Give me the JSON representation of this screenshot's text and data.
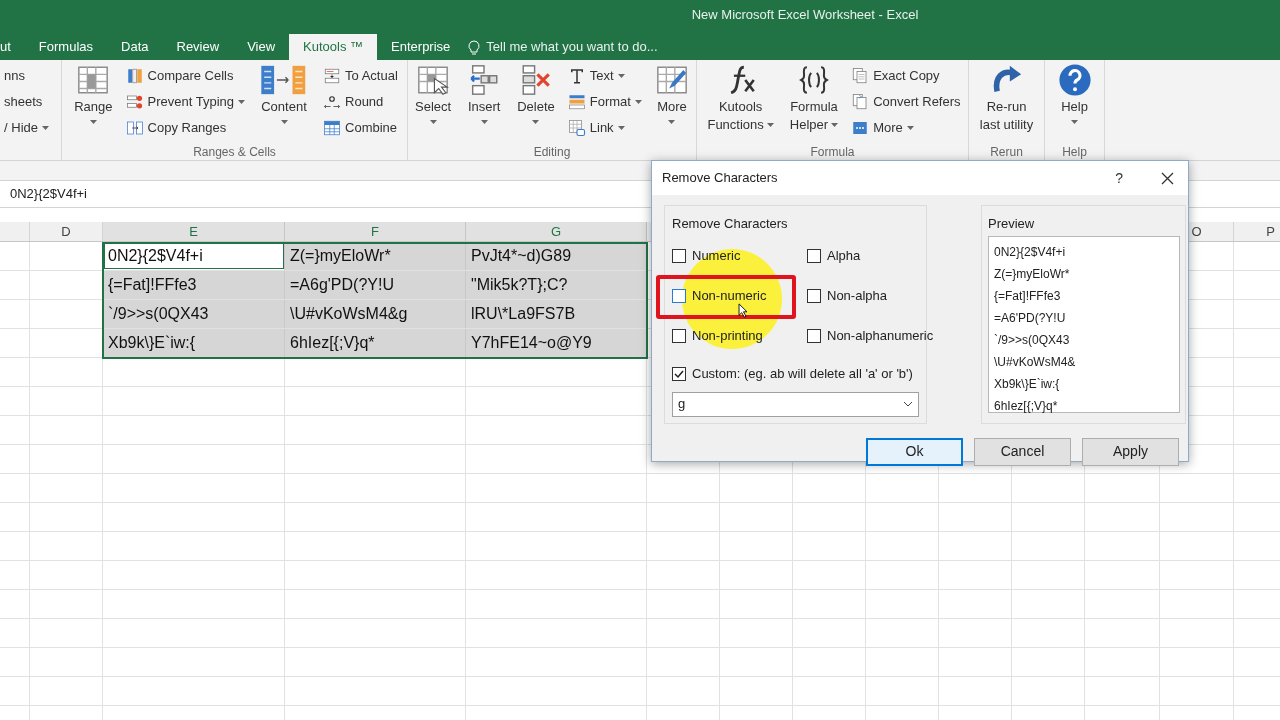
{
  "window": {
    "title": "New Microsoft Excel Worksheet - Excel"
  },
  "tabs": [
    {
      "label": "ut",
      "selected": false
    },
    {
      "label": "Formulas",
      "selected": false
    },
    {
      "label": "Data",
      "selected": false
    },
    {
      "label": "Review",
      "selected": false
    },
    {
      "label": "View",
      "selected": false
    },
    {
      "label": "Kutools ™",
      "selected": true
    },
    {
      "label": "Enterprise",
      "selected": false
    }
  ],
  "tell_me": {
    "placeholder": "Tell me what you want to do..."
  },
  "ribbon": {
    "groups": [
      {
        "items": [
          {
            "kind": "stack",
            "items": [
              {
                "label": "nns",
                "dropdown": false
              },
              {
                "label": "sheets",
                "dropdown": false
              },
              {
                "label": "/ Hide",
                "dropdown": true
              }
            ]
          }
        ]
      },
      {
        "label": "Ranges & Cells",
        "items": [
          {
            "kind": "large",
            "lines": [
              "Range"
            ],
            "dropdown": true
          },
          {
            "kind": "stack",
            "items": [
              {
                "label": "Compare Cells",
                "dropdown": false
              },
              {
                "label": "Prevent Typing",
                "dropdown": true
              },
              {
                "label": "Copy Ranges",
                "dropdown": false
              }
            ]
          },
          {
            "kind": "large",
            "lines": [
              "Content"
            ],
            "dropdown": true
          },
          {
            "kind": "stack",
            "items": [
              {
                "label": "To Actual",
                "dropdown": false
              },
              {
                "label": "Round",
                "dropdown": false
              },
              {
                "label": "Combine",
                "dropdown": false
              }
            ]
          }
        ]
      },
      {
        "label": "Editing",
        "items": [
          {
            "kind": "large",
            "lines": [
              "Select"
            ],
            "dropdown": true
          },
          {
            "kind": "large",
            "lines": [
              "Insert"
            ],
            "dropdown": true
          },
          {
            "kind": "large",
            "lines": [
              "Delete"
            ],
            "dropdown": true
          },
          {
            "kind": "stack",
            "items": [
              {
                "label": "Text",
                "dropdown": true
              },
              {
                "label": "Format",
                "dropdown": true
              },
              {
                "label": "Link",
                "dropdown": true
              }
            ]
          },
          {
            "kind": "large",
            "lines": [
              "More"
            ],
            "dropdown": true
          }
        ]
      },
      {
        "label": "Formula",
        "items": [
          {
            "kind": "large",
            "lines": [
              "Kutools",
              "Functions"
            ],
            "dropdown": true
          },
          {
            "kind": "large",
            "lines": [
              "Formula",
              "Helper"
            ],
            "dropdown": true
          },
          {
            "kind": "stack",
            "items": [
              {
                "label": "Exact Copy",
                "dropdown": false
              },
              {
                "label": "Convert Refers",
                "dropdown": false
              },
              {
                "label": "More",
                "dropdown": true
              }
            ]
          }
        ]
      },
      {
        "label": "Rerun",
        "items": [
          {
            "kind": "large",
            "lines": [
              "Re-run",
              "last utility"
            ],
            "dropdown": false
          }
        ]
      },
      {
        "label": "Help",
        "items": [
          {
            "kind": "large",
            "lines": [
              "Help"
            ],
            "dropdown": true
          }
        ]
      }
    ]
  },
  "formula_bar": {
    "value": "0N2}{2$V4f+i"
  },
  "sheet": {
    "columns": [
      "D",
      "E",
      "F",
      "G",
      "O",
      "P"
    ],
    "rows": [
      {
        "cells": [
          {
            "text": "",
            "selected": false,
            "active": false
          },
          {
            "text": "0N2}{2$V4f+i",
            "selected": true,
            "active": true
          },
          {
            "text": "Z(=}myEloWr*",
            "selected": true,
            "active": false
          },
          {
            "text": "PvJt4*~d)G89",
            "selected": true,
            "active": false
          }
        ]
      },
      {
        "cells": [
          {
            "text": "",
            "selected": false,
            "active": false
          },
          {
            "text": "{=Fat]!FFfe3",
            "selected": true,
            "active": false
          },
          {
            "text": "=A6g'PD(?Y!U",
            "selected": true,
            "active": false
          },
          {
            "text": "\"Mik5k?T};C?",
            "selected": true,
            "active": false
          }
        ]
      },
      {
        "cells": [
          {
            "text": "",
            "selected": false,
            "active": false
          },
          {
            "text": "`/9>>s(0QX43",
            "selected": true,
            "active": false
          },
          {
            "text": "\\U#vKoWsM4&g",
            "selected": true,
            "active": false
          },
          {
            "text": "lRU\\*La9FS7B",
            "selected": true,
            "active": false
          }
        ]
      },
      {
        "cells": [
          {
            "text": "",
            "selected": false,
            "active": false
          },
          {
            "text": "Xb9k\\}E`iw:{",
            "selected": true,
            "active": false
          },
          {
            "text": "6hIez[{;V}q*",
            "selected": true,
            "active": false
          },
          {
            "text": "Y7hFE14~o@Y9",
            "selected": true,
            "active": false
          }
        ]
      }
    ]
  },
  "dialog": {
    "title": "Remove Characters",
    "help": "?",
    "group_label": "Remove Characters",
    "options": [
      {
        "label": "Numeric",
        "checked": false,
        "highlighted": false
      },
      {
        "label": "Alpha",
        "checked": false,
        "highlighted": false
      },
      {
        "label": "Non-numeric",
        "checked": false,
        "highlighted": true
      },
      {
        "label": "Non-alpha",
        "checked": false,
        "highlighted": false
      },
      {
        "label": "Non-printing",
        "checked": false,
        "highlighted": false
      },
      {
        "label": "Non-alphanumeric",
        "checked": false,
        "highlighted": false
      }
    ],
    "custom": {
      "label": "Custom: (eg. ab will delete all 'a' or 'b')",
      "checked": true,
      "value": "g"
    },
    "preview": {
      "label": "Preview",
      "lines": [
        "0N2}{2$V4f+i",
        "Z(=}myEloWr*",
        "{=Fat]!FFfe3",
        "=A6'PD(?Y!U",
        "`/9>>s(0QX43",
        "\\U#vKoWsM4&",
        "Xb9k\\}E`iw:{",
        "6hIez[{;V}q*"
      ]
    },
    "buttons": [
      {
        "label": "Ok",
        "default": true
      },
      {
        "label": "Cancel",
        "default": false
      },
      {
        "label": "Apply",
        "default": false
      }
    ]
  }
}
